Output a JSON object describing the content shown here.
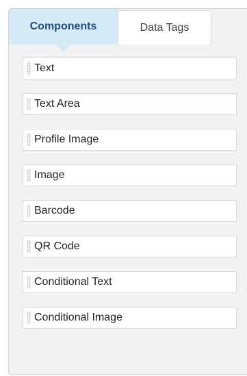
{
  "tabs": {
    "components": "Components",
    "data_tags": "Data Tags"
  },
  "items": [
    {
      "label": "Text"
    },
    {
      "label": "Text Area"
    },
    {
      "label": "Profile Image"
    },
    {
      "label": "Image"
    },
    {
      "label": "Barcode"
    },
    {
      "label": "QR Code"
    },
    {
      "label": "Conditional Text"
    },
    {
      "label": "Conditional Image"
    }
  ],
  "icons": {
    "drag_handle": "drag-handle-icon"
  },
  "colors": {
    "active_tab_bg": "#d6eaf7",
    "active_tab_text": "#1f4e79",
    "panel_bg": "#f2f2f2"
  }
}
